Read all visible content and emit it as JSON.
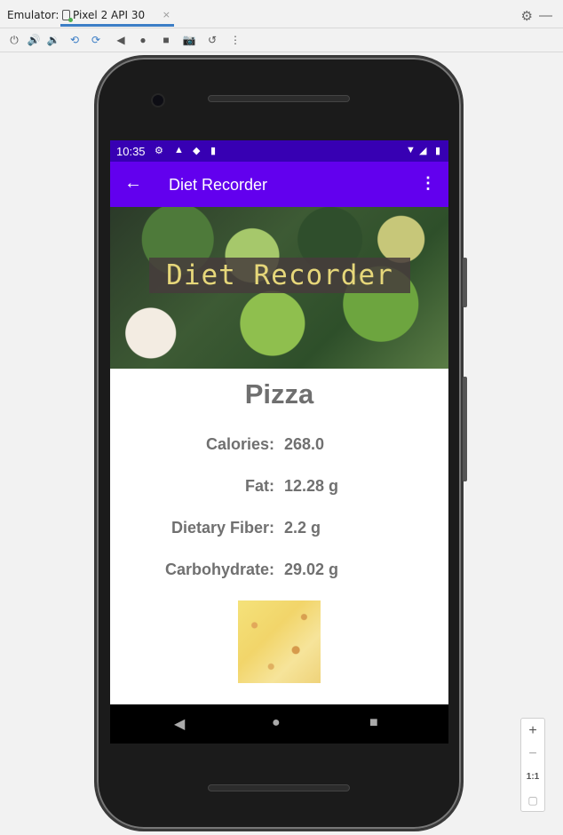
{
  "emulator": {
    "label": "Emulator:",
    "tab_title": "Pixel 2 API 30",
    "tab_close": "×"
  },
  "status_bar": {
    "time": "10:35"
  },
  "app_bar": {
    "title": "Diet Recorder",
    "back_glyph": "←",
    "more_glyph": "⋮"
  },
  "banner": {
    "title": "Diet Recorder"
  },
  "food": {
    "name": "Pizza",
    "nutrients": [
      {
        "label": "Calories:",
        "value": "268.0"
      },
      {
        "label": "Fat:",
        "value": "12.28 g"
      },
      {
        "label": "Dietary Fiber:",
        "value": "2.2 g"
      },
      {
        "label": "Carbohydrate:",
        "value": "29.02 g"
      }
    ]
  },
  "zoom_controls": {
    "plus": "+",
    "minus": "−",
    "one_to_one": "1:1"
  },
  "colors": {
    "status_bar": "#3700b3",
    "app_bar": "#6200ee",
    "text_gray": "#707070",
    "banner_title": "#e6d77a"
  }
}
